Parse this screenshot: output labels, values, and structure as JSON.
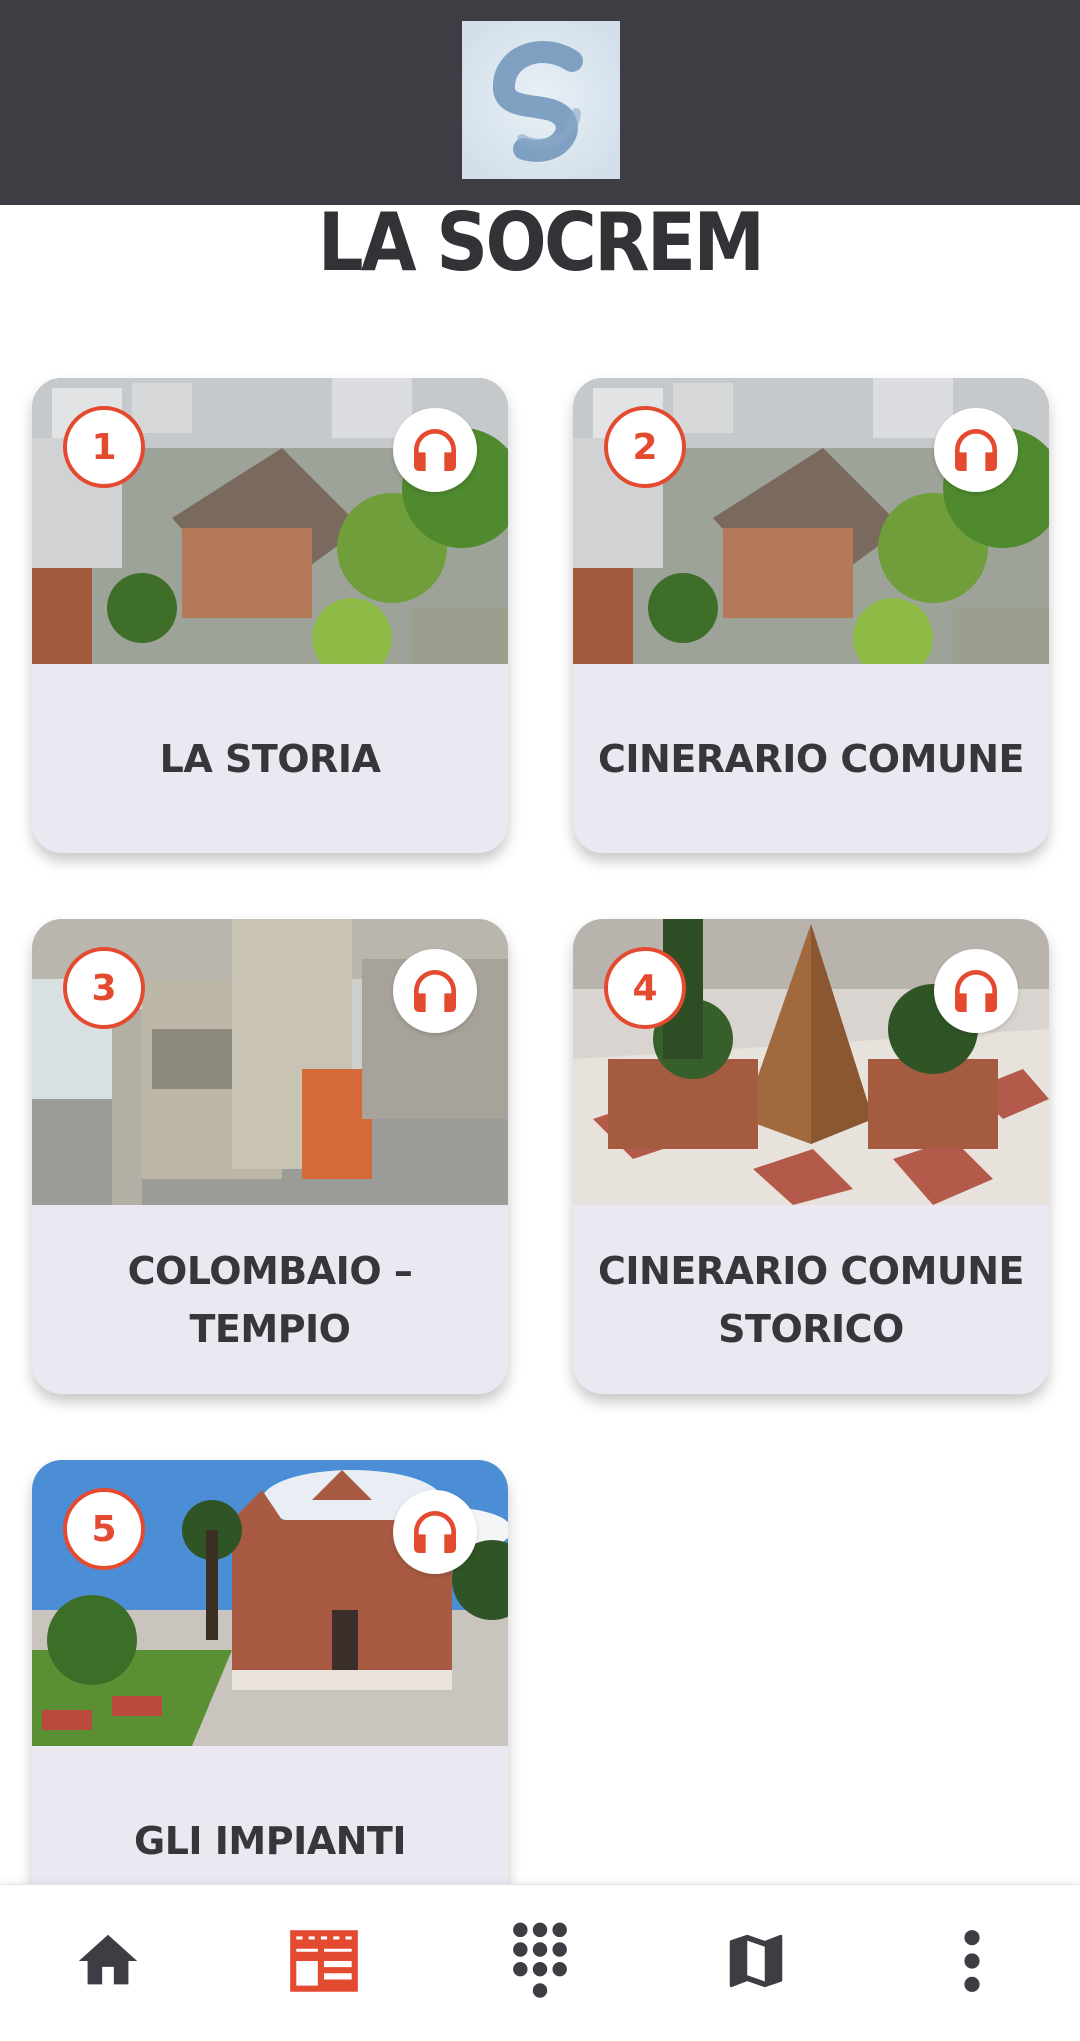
{
  "header": {
    "logo_icon": "socrem-logo"
  },
  "page": {
    "title": "LA SOCREM"
  },
  "cards": [
    {
      "number": "1",
      "label": "LA STORIA",
      "audio_icon": "headphones-icon"
    },
    {
      "number": "2",
      "label": "CINERARIO COMUNE",
      "audio_icon": "headphones-icon"
    },
    {
      "number": "3",
      "label": "COLOMBAIO – TEMPIO",
      "audio_icon": "headphones-icon"
    },
    {
      "number": "4",
      "label": "CINERARIO COMUNE STORICO",
      "audio_icon": "headphones-icon"
    },
    {
      "number": "5",
      "label": "GLI IMPIANTI",
      "audio_icon": "headphones-icon"
    }
  ],
  "bottom_nav": [
    {
      "icon": "home-icon",
      "active": false
    },
    {
      "icon": "news-list-icon",
      "active": true
    },
    {
      "icon": "keypad-icon",
      "active": false
    },
    {
      "icon": "map-icon",
      "active": false
    },
    {
      "icon": "more-icon",
      "active": false
    }
  ],
  "colors": {
    "accent": "#e44a30",
    "header_bg": "#3f3d44",
    "card_bg": "#ebe8f2",
    "nav_icon": "#3f3d44"
  }
}
